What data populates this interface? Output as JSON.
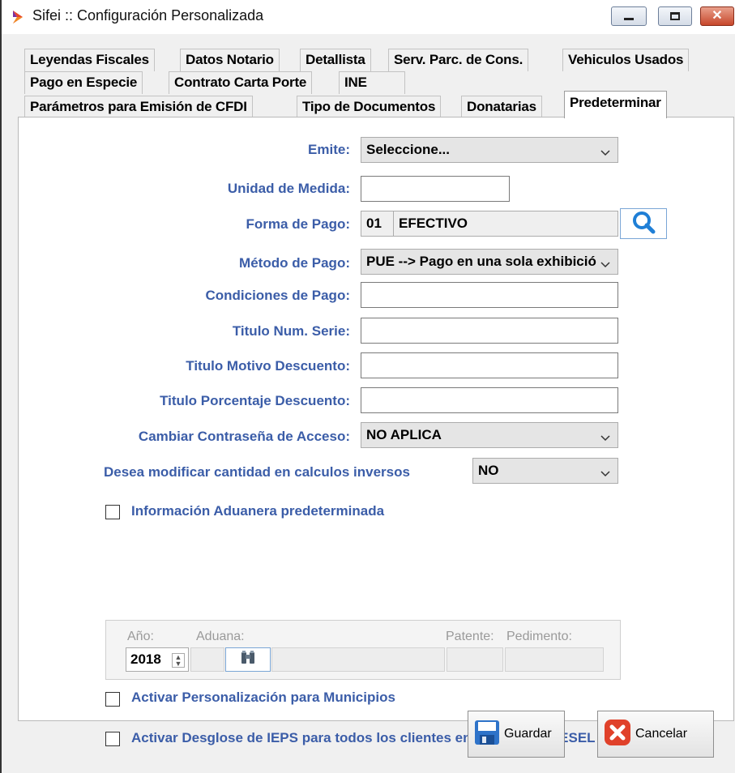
{
  "window": {
    "title": "Sifei :: Configuración Personalizada",
    "accent": "#3b5da8"
  },
  "tabs": {
    "row1": [
      "Leyendas Fiscales",
      "Datos Notario",
      "Detallista",
      "Serv. Parc. de Cons.",
      "Vehiculos Usados"
    ],
    "row2": [
      "Pago en Especie",
      "Contrato Carta Porte",
      "INE"
    ],
    "row3": [
      "Parámetros para Emisión de CFDI",
      "Tipo de Documentos",
      "Donatarias",
      "Predeterminar"
    ],
    "active": "Predeterminar"
  },
  "form": {
    "emite_label": "Emite:",
    "emite_value": "Seleccione...",
    "unidad_label": "Unidad de Medida:",
    "unidad_value": "",
    "forma_label": "Forma de Pago:",
    "forma_code": "01",
    "forma_value": "EFECTIVO",
    "metodo_label": "Método de Pago:",
    "metodo_value": "PUE --> Pago en una sola exhibición",
    "condiciones_label": "Condiciones de Pago:",
    "condiciones_value": "",
    "serie_label": "Titulo Num. Serie:",
    "serie_value": "",
    "motivo_label": "Titulo Motivo Descuento:",
    "motivo_value": "",
    "porcentaje_label": "Titulo Porcentaje Descuento:",
    "porcentaje_value": "",
    "contrasena_label": "Cambiar Contraseña de Acceso:",
    "contrasena_value": "NO APLICA",
    "inversos_label": "Desea modificar cantidad en calculos inversos",
    "inversos_value": "NO"
  },
  "aduanera": {
    "checkbox_label": "Información Aduanera predeterminada",
    "checked": false,
    "anio_label": "Año:",
    "anio_value": "2018",
    "aduana_label": "Aduana:",
    "patente_label": "Patente:",
    "pedimento_label": "Pedimento:"
  },
  "options": {
    "municipios_label": "Activar Personalización para Municipios",
    "municipios_checked": false,
    "ieps_label": "Activar Desglose de IEPS para todos los clientes en el caso de DIESEL",
    "ieps_checked": false
  },
  "buttons": {
    "guardar": "Guardar",
    "cancelar": "Cancelar"
  }
}
